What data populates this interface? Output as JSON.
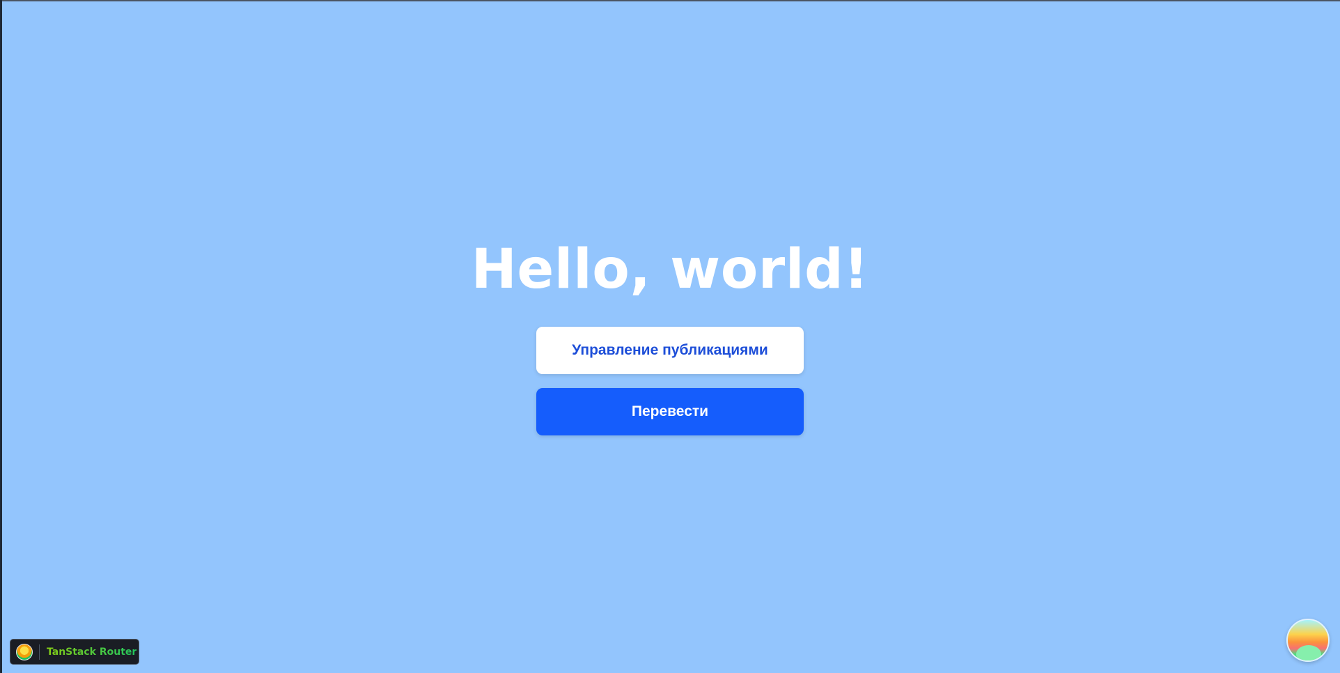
{
  "page": {
    "title": "Hello, world!"
  },
  "actions": {
    "manage_publications_label": "Управление публикациями",
    "translate_label": "Перевести"
  },
  "devtools": {
    "label": "TanStack Router",
    "logo_icon": "tanstack-logo-icon"
  },
  "floating_button": {
    "icon": "devtools-toggle-icon"
  },
  "colors": {
    "background": "#93c5fd",
    "primary": "#155dfc",
    "white_button_text": "#1d4ed8",
    "title": "#ffffff"
  }
}
